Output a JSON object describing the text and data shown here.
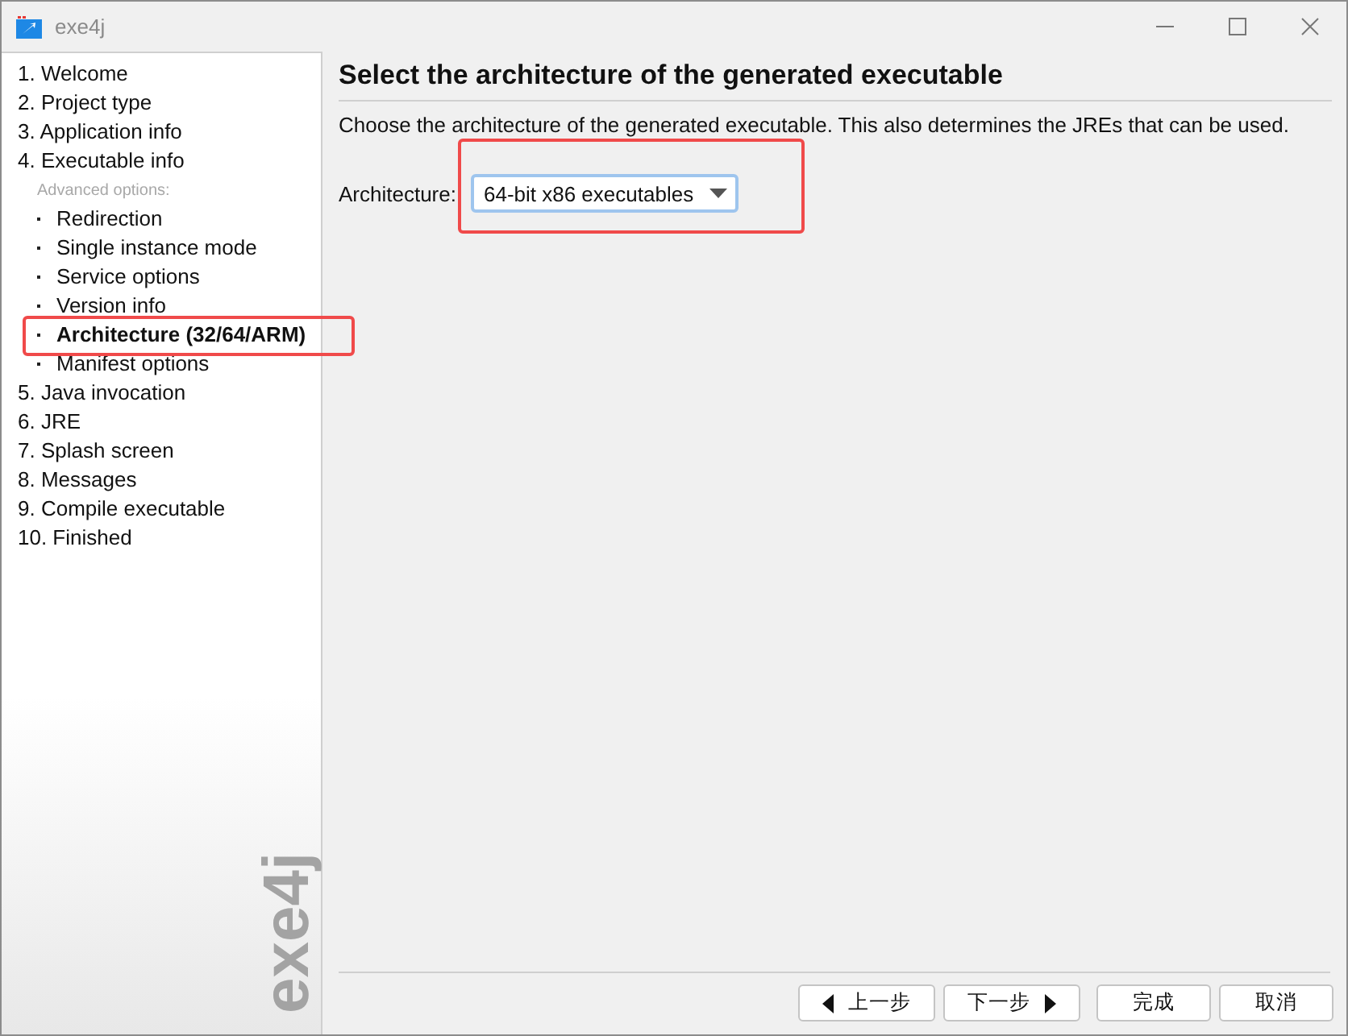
{
  "window": {
    "title": "exe4j"
  },
  "sidebar": {
    "steps": [
      {
        "label": "1. Welcome",
        "selected": false,
        "highlighted": false
      },
      {
        "label": "2. Project type",
        "selected": false,
        "highlighted": false
      },
      {
        "label": "3. Application info",
        "selected": false,
        "highlighted": false
      },
      {
        "label": "4. Executable info",
        "selected": false,
        "highlighted": false,
        "children_heading": "Advanced options:",
        "children": [
          {
            "label": "Redirection",
            "selected": false,
            "highlighted": false
          },
          {
            "label": "Single instance mode",
            "selected": false,
            "highlighted": false
          },
          {
            "label": "Service options",
            "selected": false,
            "highlighted": false
          },
          {
            "label": "Version info",
            "selected": false,
            "highlighted": false
          },
          {
            "label": "Architecture (32/64/ARM)",
            "selected": true,
            "highlighted": true
          },
          {
            "label": "Manifest options",
            "selected": false,
            "highlighted": false
          }
        ]
      },
      {
        "label": "5. Java invocation",
        "selected": false,
        "highlighted": false
      },
      {
        "label": "6. JRE",
        "selected": false,
        "highlighted": false
      },
      {
        "label": "7. Splash screen",
        "selected": false,
        "highlighted": false
      },
      {
        "label": "8. Messages",
        "selected": false,
        "highlighted": false
      },
      {
        "label": "9. Compile executable",
        "selected": false,
        "highlighted": false
      },
      {
        "label": "10. Finished",
        "selected": false,
        "highlighted": false
      }
    ],
    "brand": "exe4j"
  },
  "page": {
    "title": "Select the architecture of the generated executable",
    "description": "Choose the architecture of the generated executable. This also determines the JREs that can be used.",
    "architecture": {
      "label": "Architecture:",
      "value": "64-bit x86 executables",
      "focused": true,
      "highlighted": true
    }
  },
  "buttons": [
    {
      "kind": "back",
      "label": "上一步"
    },
    {
      "kind": "next",
      "label": "下一步"
    },
    {
      "kind": "finish",
      "label": "完成"
    },
    {
      "kind": "cancel",
      "label": "取消"
    }
  ]
}
